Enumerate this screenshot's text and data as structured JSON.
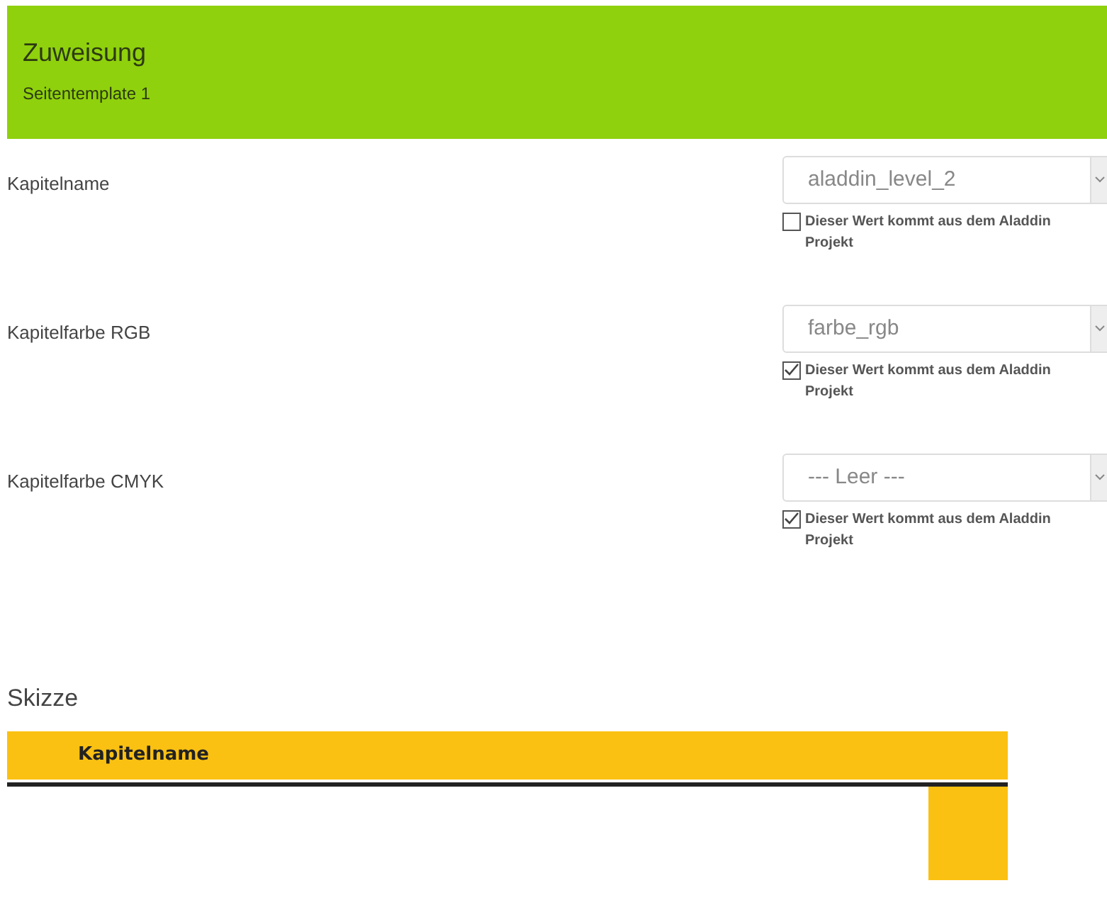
{
  "header": {
    "title": "Zuweisung",
    "subtitle": "Seitentemplate 1"
  },
  "fields": [
    {
      "label": "Kapitelname",
      "value": "aladdin_level_2",
      "checkbox": {
        "label": "Dieser Wert kommt aus dem Aladdin Projekt",
        "checked": false
      }
    },
    {
      "label": "Kapitelfarbe RGB",
      "value": "farbe_rgb",
      "checkbox": {
        "label": "Dieser Wert kommt aus dem Aladdin Projekt",
        "checked": true
      }
    },
    {
      "label": "Kapitelfarbe CMYK",
      "value": "--- Leer ---",
      "checkbox": {
        "label": "Dieser Wert kommt aus dem Aladdin Projekt",
        "checked": true
      }
    }
  ],
  "sketch": {
    "title": "Skizze",
    "bar_label": "Kapitelname"
  }
}
